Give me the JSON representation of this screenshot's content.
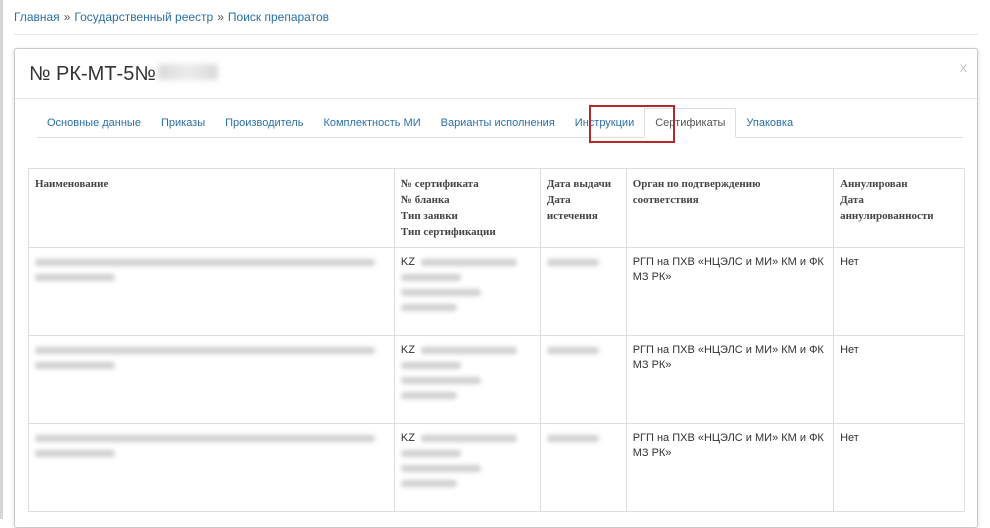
{
  "breadcrumb": {
    "items": [
      "Главная",
      "Государственный реестр",
      "Поиск препаратов"
    ],
    "separator": "»"
  },
  "modal": {
    "title": "№ РК-МТ-5№",
    "close_label": "x"
  },
  "tabs": [
    {
      "label": "Основные данные",
      "active": false
    },
    {
      "label": "Приказы",
      "active": false
    },
    {
      "label": "Производитель",
      "active": false
    },
    {
      "label": "Комплектность МИ",
      "active": false
    },
    {
      "label": "Варианты исполнения",
      "active": false
    },
    {
      "label": "Инструкции",
      "active": false
    },
    {
      "label": "Сертификаты",
      "active": true
    },
    {
      "label": "Упаковка",
      "active": false
    }
  ],
  "table": {
    "headers": {
      "name": [
        "Наименование"
      ],
      "certificate": [
        "№ сертификата",
        "№ бланка",
        "Тип заявки",
        "Тип сертификации"
      ],
      "dates": [
        "Дата выдачи",
        "Дата",
        "истечения"
      ],
      "authority": [
        "Орган по подтверждению",
        "соответствия"
      ],
      "annulled": [
        "Аннулирован",
        "Дата",
        "аннулированности"
      ]
    },
    "rows": [
      {
        "cert_prefix": "KZ",
        "authority": "РГП на ПХВ «НЦЭЛС и МИ» КМ и ФК МЗ РК»",
        "annulled": "Нет"
      },
      {
        "cert_prefix": "KZ",
        "authority": "РГП на ПХВ «НЦЭЛС и МИ» КМ и ФК МЗ РК»",
        "annulled": "Нет"
      },
      {
        "cert_prefix": "KZ",
        "authority": "РГП на ПХВ «НЦЭЛС и МИ» КМ и ФК МЗ РК»",
        "annulled": "Нет"
      }
    ]
  },
  "colors": {
    "link": "#2a6fa8",
    "highlight": "#b42a2a",
    "border": "#dddddd"
  }
}
